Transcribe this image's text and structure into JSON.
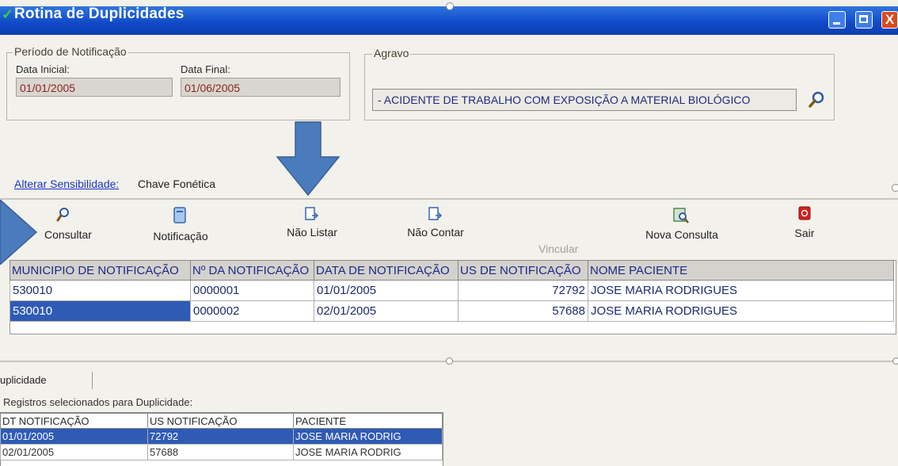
{
  "window": {
    "title": "Rotina de Duplicidades",
    "close_glyph": "X"
  },
  "periodo": {
    "legend": "Período de Notificação",
    "data_inicial_label": "Data Inicial:",
    "data_inicial_value": "01/01/2005",
    "data_final_label": "Data Final:",
    "data_final_value": "01/06/2005"
  },
  "agravo": {
    "legend": "Agravo",
    "value": " - ACIDENTE DE TRABALHO COM EXPOSIÇÃO A MATERIAL BIOLÓGICO",
    "search_icon": "magnifier-icon"
  },
  "sensibilidade": {
    "link_label": "Alterar Sensibilidade:",
    "value": "Chave Fonética"
  },
  "toolbar": {
    "consultar": "Consultar",
    "notificacao": "Notificação",
    "nao_listar": "Não Listar",
    "nao_contar": "Não Contar",
    "vincular": "Vincular",
    "nova_consulta": "Nova Consulta",
    "sair": "Sair"
  },
  "grid": {
    "columns": [
      "MUNICIPIO DE NOTIFICAÇÃO",
      "Nº DA NOTIFICAÇÃO",
      "DATA DE NOTIFICAÇÃO",
      "US DE NOTIFICAÇÃO",
      "NOME PACIENTE"
    ],
    "rows": [
      [
        "530010",
        "0000001",
        "01/01/2005",
        "72792",
        "JOSE MARIA RODRIGUES"
      ],
      [
        "530010",
        "0000002",
        "02/01/2005",
        "57688",
        "JOSE MARIA RODRIGUES"
      ]
    ]
  },
  "bottom": {
    "tab_label": "uplicidade",
    "selected_label": "Registros selecionados para Duplicidade:",
    "columns": [
      "DT NOTIFICAÇÃO",
      "US NOTIFICAÇÃO",
      "PACIENTE"
    ],
    "rows": [
      [
        "01/01/2005",
        "72792",
        "JOSE MARIA RODRIG"
      ],
      [
        "02/01/2005",
        "57688",
        "JOSE MARIA RODRIG"
      ]
    ]
  },
  "annotation_colors": {
    "arrow": "#4a7bbd"
  }
}
